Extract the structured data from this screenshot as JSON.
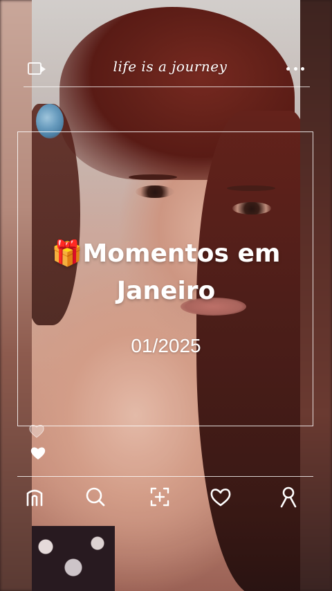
{
  "header": {
    "title": "life is a journey",
    "left_icon": "video-icon",
    "right_icon": "more-icon"
  },
  "card": {
    "emoji": "🎁",
    "headline": "Momentos em Janeiro",
    "date": "01/2025"
  },
  "reactions": {
    "icons": [
      "heart-outline-icon",
      "heart-filled-icon"
    ]
  },
  "bottom_nav": {
    "items": [
      {
        "name": "home",
        "icon": "home-icon"
      },
      {
        "name": "search",
        "icon": "search-icon"
      },
      {
        "name": "add",
        "icon": "add-icon"
      },
      {
        "name": "likes",
        "icon": "heart-icon"
      },
      {
        "name": "profile",
        "icon": "profile-icon"
      }
    ]
  },
  "colors": {
    "overlay_text": "#ffffff",
    "hair": "#6a241d",
    "skin": "#e8b7a3"
  }
}
